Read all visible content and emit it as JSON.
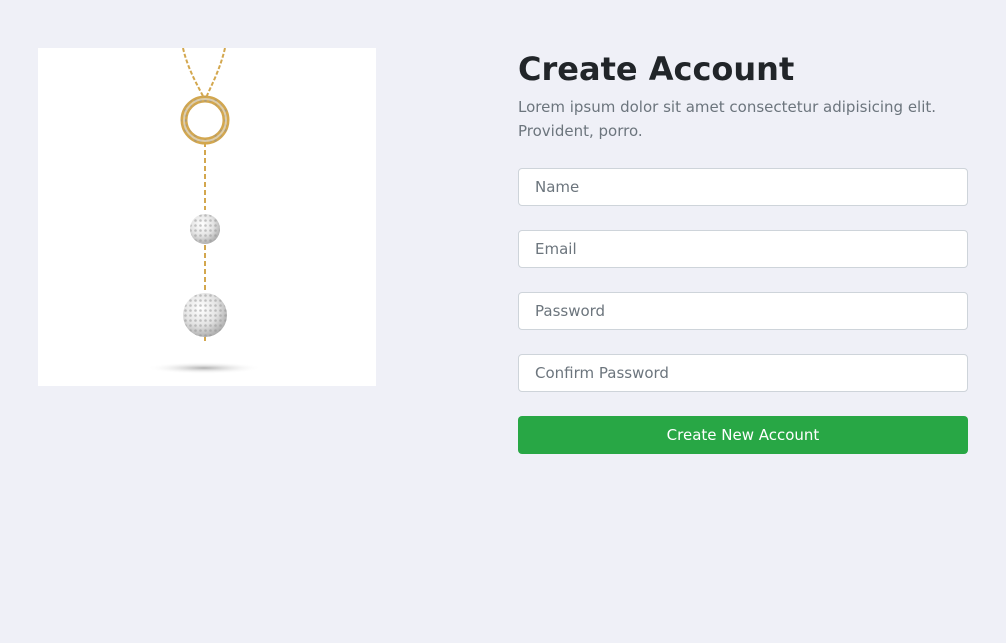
{
  "product_image": {
    "alt": "Gold necklace with crystal ring and two crystal ball pendants"
  },
  "form": {
    "title": "Create Account",
    "subtitle": "Lorem ipsum dolor sit amet consectetur adipisicing elit. Provident, porro.",
    "name_placeholder": "Name",
    "email_placeholder": "Email",
    "password_placeholder": "Password",
    "confirm_password_placeholder": "Confirm Password",
    "submit_label": "Create New Account"
  },
  "colors": {
    "page_background": "#eff0f7",
    "title_text": "#212529",
    "muted_text": "#6c757d",
    "input_border": "#ced4da",
    "primary_button": "#28a745",
    "necklace_gold": "#d3a74e",
    "crystal_silver": "#d9d9d9"
  }
}
